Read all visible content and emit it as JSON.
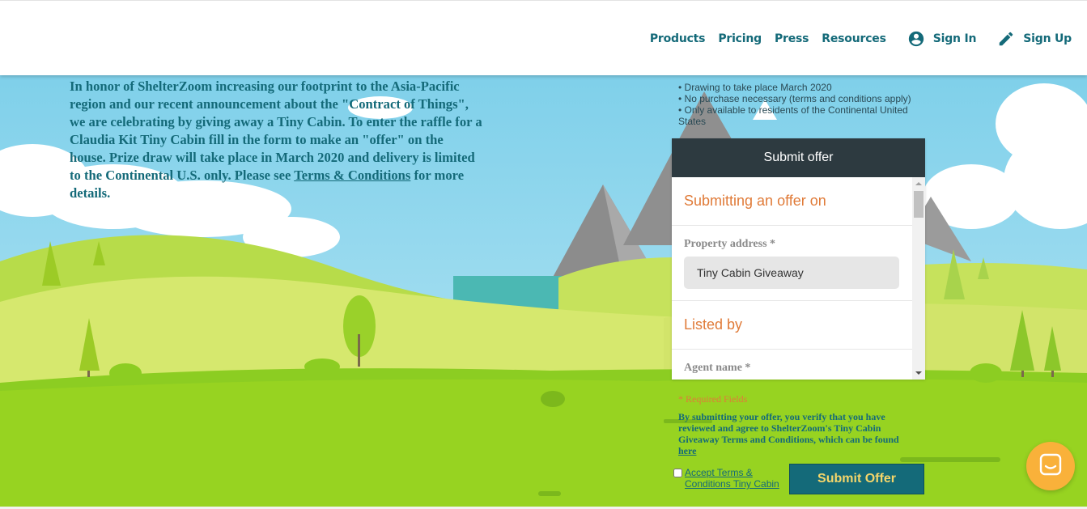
{
  "nav": {
    "products": "Products",
    "pricing": "Pricing",
    "press": "Press",
    "resources": "Resources",
    "sign_in": "Sign In",
    "sign_up": "Sign Up"
  },
  "intro": {
    "text": "In honor of ShelterZoom increasing our footprint to the Asia-Pacific region and our recent announcement about the \"Contract of Things\", we are celebrating by giving away a Tiny Cabin. To enter the raffle for a Claudia Kit Tiny Cabin fill in the form to make an \"offer\" on the house. Prize draw will take place in March 2020 and delivery is limited to the Continental U.S. only. Please see ",
    "terms_link": "Terms & Conditions",
    "suffix": " for more details."
  },
  "bullets": [
    "• Drawing to take place March 2020",
    "• No purchase necessary (terms and conditions apply)",
    "• Only available to residents of the Continental United States"
  ],
  "offer_form": {
    "header": "Submit offer",
    "section1_title": "Submitting an offer on",
    "property_label": "Property address *",
    "property_value": "Tiny Cabin Giveaway",
    "section2_title": "Listed by",
    "agent_label": "Agent name *"
  },
  "required_note": "* Required Fields",
  "disclaimer": {
    "text": "By submitting your offer, you verify that you have reviewed and agree to ShelterZoom's Tiny Cabin Giveaway Terms and Conditions, which can be found ",
    "link": "here"
  },
  "accept_label": "Accept Terms & Conditions Tiny Cabin",
  "submit_button": "Submit Offer",
  "colors": {
    "brand_teal": "#146a79",
    "accent_orange": "#e07b39",
    "form_header": "#2d3a40",
    "chat_button": "#f9b13a"
  },
  "icons": {
    "sign_in": "account-circle-icon",
    "sign_up": "pencil-icon",
    "chat": "chat-bubble-icon"
  }
}
